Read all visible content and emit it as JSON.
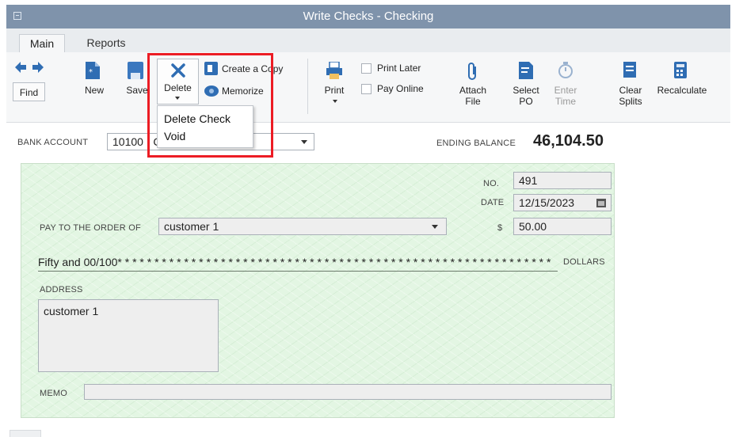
{
  "window": {
    "title": "Write Checks - Checking"
  },
  "tabs": [
    {
      "label": "Main"
    },
    {
      "label": "Reports"
    }
  ],
  "toolbar": {
    "find": "Find",
    "new": "New",
    "save": "Save",
    "delete": "Delete",
    "create_copy": "Create a Copy",
    "memorize": "Memorize",
    "print": "Print",
    "print_later": "Print Later",
    "pay_online": "Pay Online",
    "attach_1": "Attach",
    "attach_2": "File",
    "select_1": "Select",
    "select_2": "PO",
    "enter_1": "Enter",
    "enter_2": "Time",
    "clear_1": "Clear",
    "clear_2": "Splits",
    "recalculate": "Recalculate"
  },
  "delete_menu": {
    "items": [
      "Delete Check",
      "Void"
    ]
  },
  "account": {
    "label": "BANK ACCOUNT",
    "value": "10100 · C",
    "ending_label": "ENDING BALANCE",
    "ending_balance": "46,104.50"
  },
  "check": {
    "no_label": "NO.",
    "no": "491",
    "date_label": "DATE",
    "date": "12/15/2023",
    "payee_label": "PAY TO THE ORDER OF",
    "payee": "customer 1",
    "amount_label": "$",
    "amount": "50.00",
    "written_amount": "Fifty and 00/100* * * * * * * * * * * * * * * * * * * * * * * * * * * * * * * * * * * * * * * * * * * * * * * * * * * * * * * * * * *",
    "dollars_label": "DOLLARS",
    "address_label": "ADDRESS",
    "address": "customer 1",
    "memo_label": "MEMO",
    "memo": ""
  },
  "colors": {
    "highlight": "#ec1c24",
    "check_bg": "#e3f6e3",
    "titlebar": "#7f93ab"
  }
}
